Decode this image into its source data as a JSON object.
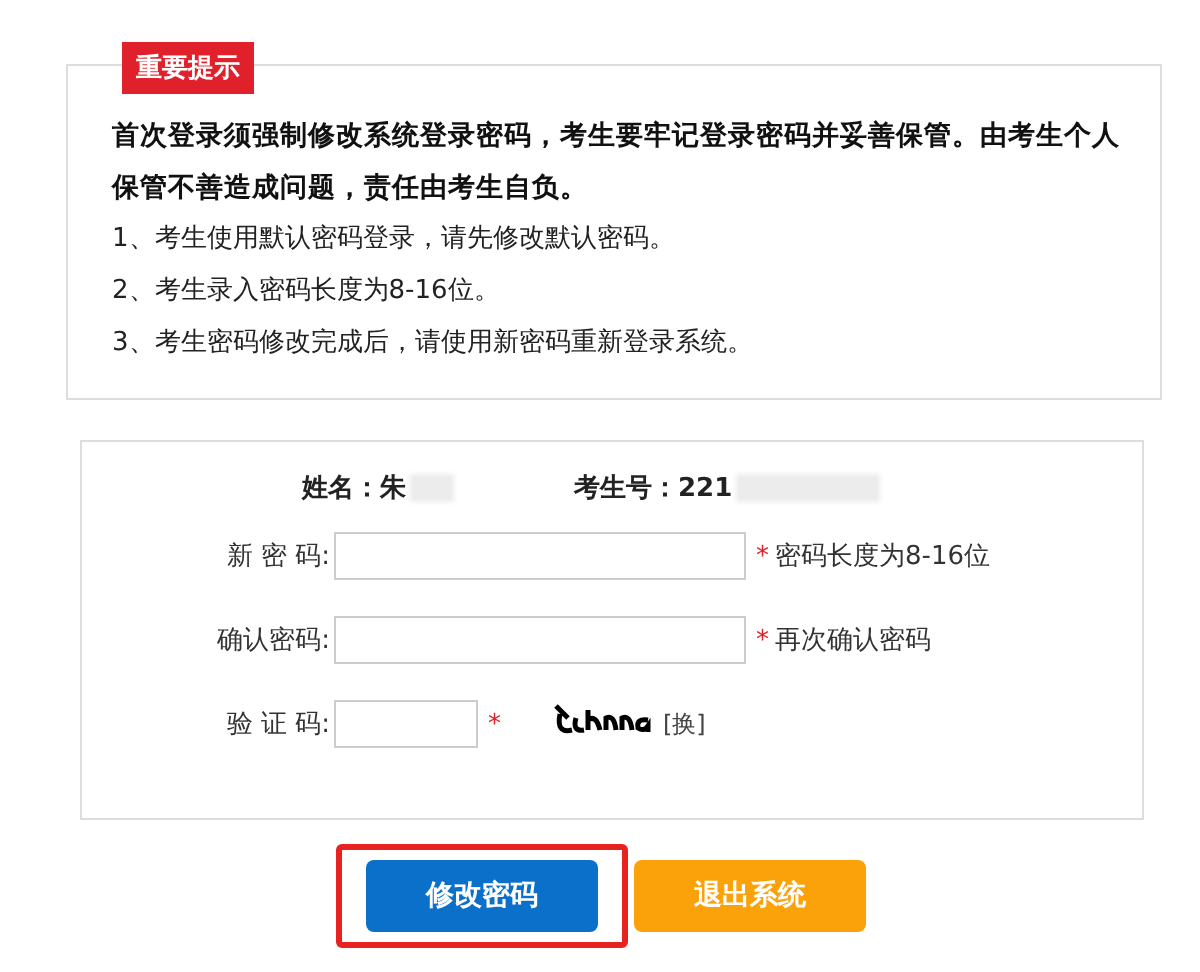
{
  "notice": {
    "tag": "重要提示",
    "headline": "首次登录须强制修改系统登录密码，考生要牢记登录密码并妥善保管。由考生个人保管不善造成问题，责任由考生自负。",
    "items": [
      "1、考生使用默认密码登录，请先修改默认密码。",
      "2、考生录入密码长度为8-16位。",
      "3、考生密码修改完成后，请使用新密码重新登录系统。"
    ]
  },
  "form": {
    "info": [
      {
        "label": "姓名：",
        "value": "朱"
      },
      {
        "label": "考生号：",
        "value": "221"
      }
    ],
    "fields": [
      {
        "kind": "wide",
        "label": "新 密 码:",
        "required": "*",
        "hint": "密码长度为8-16位"
      },
      {
        "kind": "wide",
        "label": "确认密码:",
        "required": "*",
        "hint": "再次确认密码"
      },
      {
        "kind": "captcha",
        "label": "验 证 码:",
        "required": "*",
        "hint": "[换]"
      }
    ]
  },
  "buttons": [
    {
      "label": "修改密码",
      "kind": "primary",
      "highlighted": true
    },
    {
      "label": "退出系统",
      "kind": "warning",
      "highlighted": false
    }
  ]
}
